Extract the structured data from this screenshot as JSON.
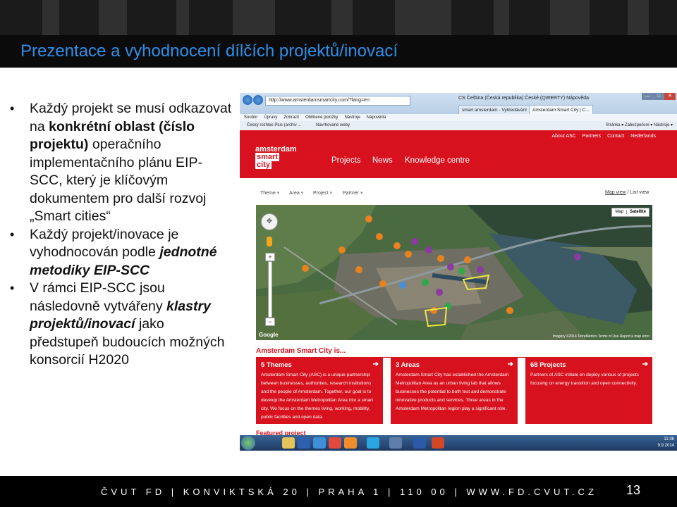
{
  "slide": {
    "title": "Prezentace a vyhodnocení dílčích projektů/inovací",
    "footer": "ČVUT FD | KONVIKTSKÁ 20 | PRAHA 1 | 110 00 | WWW.FD.CVUT.CZ",
    "page_number": "13",
    "title_color": "#2f8fe8"
  },
  "bullets": [
    {
      "bullet": "•",
      "parts": [
        {
          "t": "Každý projekt se musí odkazovat na ",
          "s": "n"
        },
        {
          "t": "konkrétní oblast (číslo projektu)",
          "s": "b"
        },
        {
          "t": " operačního implementačního plánu EIP-SCC, který je klíčovým dokumentem pro další rozvoj „Smart cities“",
          "s": "n"
        }
      ]
    },
    {
      "bullet": "•",
      "parts": [
        {
          "t": "Každý projekt/inovace je vyhodnocován podle ",
          "s": "n"
        },
        {
          "t": "jednotné metodiky EIP-SCC",
          "s": "bi"
        }
      ]
    },
    {
      "bullet": "•",
      "parts": [
        {
          "t": "V rámci EIP-SCC jsou následovně vytvářeny ",
          "s": "n"
        },
        {
          "t": "klastry projektů/inovací",
          "s": "bi"
        },
        {
          "t": " jako předstupeň budoucích možných konsorcií H2020",
          "s": "n"
        }
      ]
    }
  ],
  "browser": {
    "address": "http://www.amsterdamsmartcity.com/?lang=en",
    "tabs": [
      "smart amsterdam - Vyhledávání",
      "Amsterdam Smart City | C..."
    ],
    "language_bar": "CS Čeština (Česká republika)   České (QWERTY)   Nápověda",
    "menu": [
      "Soubor",
      "Úpravy",
      "Zobrazit",
      "Oblíbené položky",
      "Nástroje",
      "Nápověda"
    ],
    "favorites": [
      "Český rozhlas Plus (archiv ...",
      "Navrhované weby"
    ],
    "tools": "Stránka ▾  Zabezpečení ▾  Nástroje ▾",
    "window_buttons": [
      "—",
      "□",
      "✕"
    ]
  },
  "site": {
    "brand_color": "#d7111d",
    "logo_line1": "amsterdam",
    "logo_word": "smart",
    "logo_word2": "city",
    "nav": [
      "Projects",
      "News",
      "Knowledge centre"
    ],
    "top_links": [
      "About ASC",
      "Partners",
      "Contact",
      "Nederlands"
    ],
    "filters": [
      "Theme",
      "Area",
      "Project",
      "Partner"
    ],
    "map_view": "Map view",
    "list_view": "List view",
    "map_types": [
      "Map",
      "Satellite"
    ],
    "map_google": "Google",
    "map_copyright": "Imagery ©2014 TerraMetrics   Terms of Use   Report a map error",
    "section_title": "Amsterdam Smart City is...",
    "cards": [
      {
        "title": "5 Themes",
        "arrow": "➔",
        "text": "Amsterdam Smart City (ASC) is a unique partnership between businesses, authorities, research institutions and the people of Amsterdam. Together, our goal is to develop the Amsterdam Metropolitan Area into a smart city. We focus on the themes living, working, mobility, public facilities and open data."
      },
      {
        "title": "3 Areas",
        "arrow": "➔",
        "text": "Amsterdam Smart City has established the Amsterdam Metropolitan Area as an urban living lab that allows businesses the potential to both test and demonstrate innovative products and services. Three areas in the Amsterdam Metropolitan region play a significant role."
      },
      {
        "title": "68 Projects",
        "arrow": "➔",
        "text": "Partners of ASC initiate en deploy various of projects focusing on energy transition and open connectivity."
      }
    ],
    "featured": "Featured project"
  },
  "taskbar": {
    "time": "11:36",
    "date": "9.9.2014",
    "apps": [
      "explorer-icon",
      "word-icon",
      "ie-icon",
      "chrome-icon",
      "media-icon",
      "skype-icon",
      "powerpoint-icon"
    ]
  }
}
